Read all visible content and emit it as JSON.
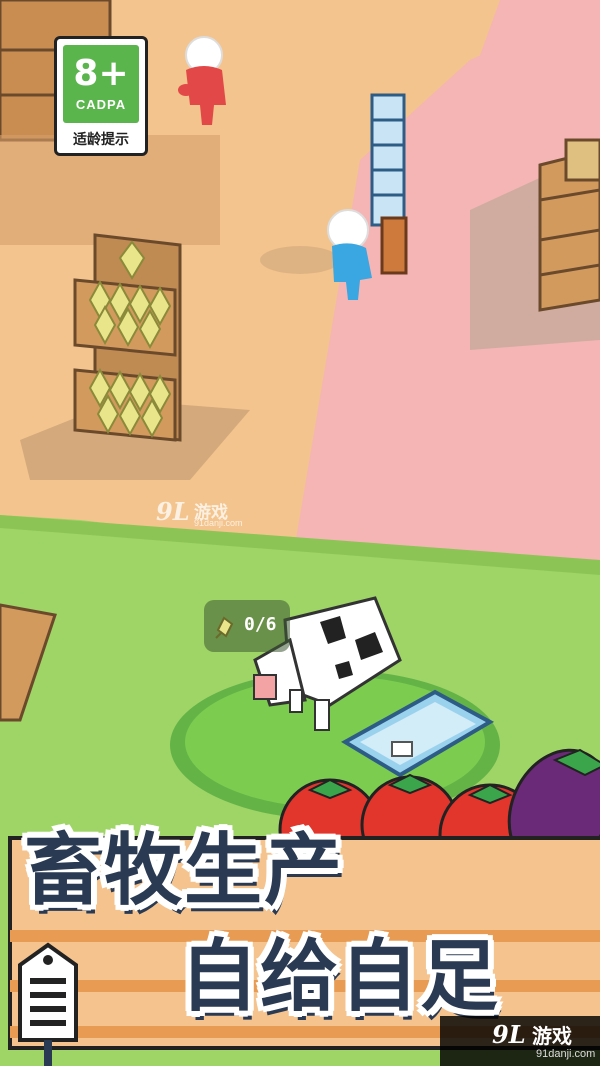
{
  "age_rating": {
    "age": "8+",
    "org": "CADPA",
    "tip": "适龄提示",
    "color": "#5ab54d"
  },
  "hud": {
    "feed_counter": "0/6",
    "feed_icon": "wheat-icon"
  },
  "title": {
    "line1": "畜牧生产",
    "line2": "自给自足"
  },
  "watermark_center": {
    "logo": "9L",
    "name": "游戏",
    "url": "91danji.com"
  },
  "watermark_corner": {
    "logo": "9L",
    "name": "游戏",
    "url": "91danji.com"
  },
  "colors": {
    "floor": "#f3c48d",
    "pink_zone": "#f5b5b4",
    "grass": "#9fd466",
    "pen": "#7ccc4f",
    "title_text": "#2a3a52",
    "banner": "#f5c38d"
  }
}
